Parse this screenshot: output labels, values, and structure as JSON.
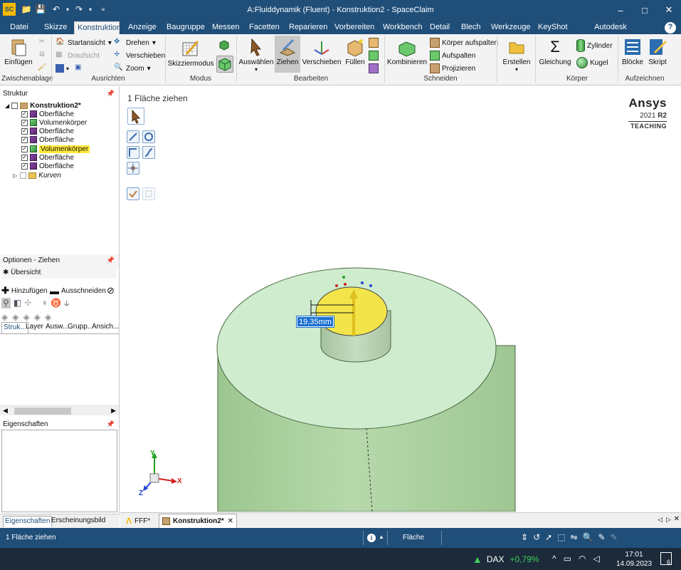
{
  "window": {
    "title": "A:Fluiddynamik (Fluent) - Konstruktion2 - SpaceClaim",
    "minimize": "–",
    "maximize": "□",
    "close": "✕"
  },
  "ribbon_tabs": [
    "Datei",
    "Skizze",
    "Konstruktion",
    "Anzeige",
    "Baugruppe",
    "Messen",
    "Facetten",
    "Reparieren",
    "Vorbereiten",
    "Workbench",
    "Detail",
    "Blech",
    "Werkzeuge",
    "KeyShot",
    "Autodesk Simulation"
  ],
  "active_tab": "Konstruktion",
  "help": "?",
  "ribbon": {
    "zwischenablage": {
      "label": "Zwischenablage",
      "einfuegen": "Einfügen"
    },
    "ausrichten": {
      "label": "Ausrichten",
      "startansicht": "Startansicht",
      "draufsicht": "Draufsicht",
      "drehen": "Drehen",
      "verschieben": "Verschieben",
      "zoom": "Zoom"
    },
    "modus": {
      "label": "Modus",
      "skizziermodus": "Skizziermodus"
    },
    "bearbeiten": {
      "label": "Bearbeiten",
      "auswaehlen": "Auswählen",
      "ziehen": "Ziehen",
      "verschieben": "Verschieben",
      "fuellen": "Füllen"
    },
    "schneiden": {
      "label": "Schneiden",
      "kombinieren": "Kombinieren",
      "koerper_aufspalten": "Körper aufspalten",
      "aufspalten": "Aufspalten",
      "projizieren": "Projizieren"
    },
    "erstellen": {
      "label": "Erstellen"
    },
    "koerper": {
      "label": "Körper",
      "gleichung": "Gleichung",
      "zylinder": "Zylinder",
      "kugel": "Kugel"
    },
    "aufzeichnen": {
      "label": "Aufzeichnen",
      "bloecke": "Blöcke",
      "skript": "Skript"
    }
  },
  "structure": {
    "header": "Struktur",
    "root": "Konstruktion2*",
    "items": [
      "Oberfläche",
      "Volumenkörper",
      "Oberfläche",
      "Oberfläche",
      "Volumenkörper",
      "Oberfläche",
      "Oberfläche"
    ],
    "curves": "Kurven"
  },
  "left_tabs": [
    "Struk...",
    "Layer",
    "Ausw...",
    "Grupp...",
    "Ansich..."
  ],
  "options": {
    "header": "Optionen - Ziehen",
    "overview": "Übersicht",
    "add": "Hinzufügen",
    "cut": "Ausschneiden"
  },
  "properties": {
    "header": "Eigenschaften"
  },
  "left_bottom_tabs": [
    "Eigenschaften",
    "Erscheinungsbild"
  ],
  "viewport": {
    "tool_title": "1 Fläche ziehen",
    "brand": "Ansys",
    "version_year": "2021",
    "version_release": "R2",
    "edition": "TEACHING",
    "dimension": "19,35mm",
    "axis_x": "X",
    "axis_y": "Y",
    "axis_z": "Z"
  },
  "doc_tabs": [
    "FFF*",
    "Konstruktion2*"
  ],
  "status": {
    "left": "1 Fläche ziehen",
    "selection": "Fläche"
  },
  "taskbar": {
    "ticker": "DAX",
    "change": "+0,79%",
    "time": "17:01",
    "date": "14.09.2023",
    "notifications": "6"
  },
  "colors": {
    "titlebar": "#1f4e79",
    "cylinder_top": "#cfeccf",
    "cylinder_side": "#a9cfa0",
    "selected_face": "#f2e44a",
    "dax_up": "#3fcf5a"
  }
}
